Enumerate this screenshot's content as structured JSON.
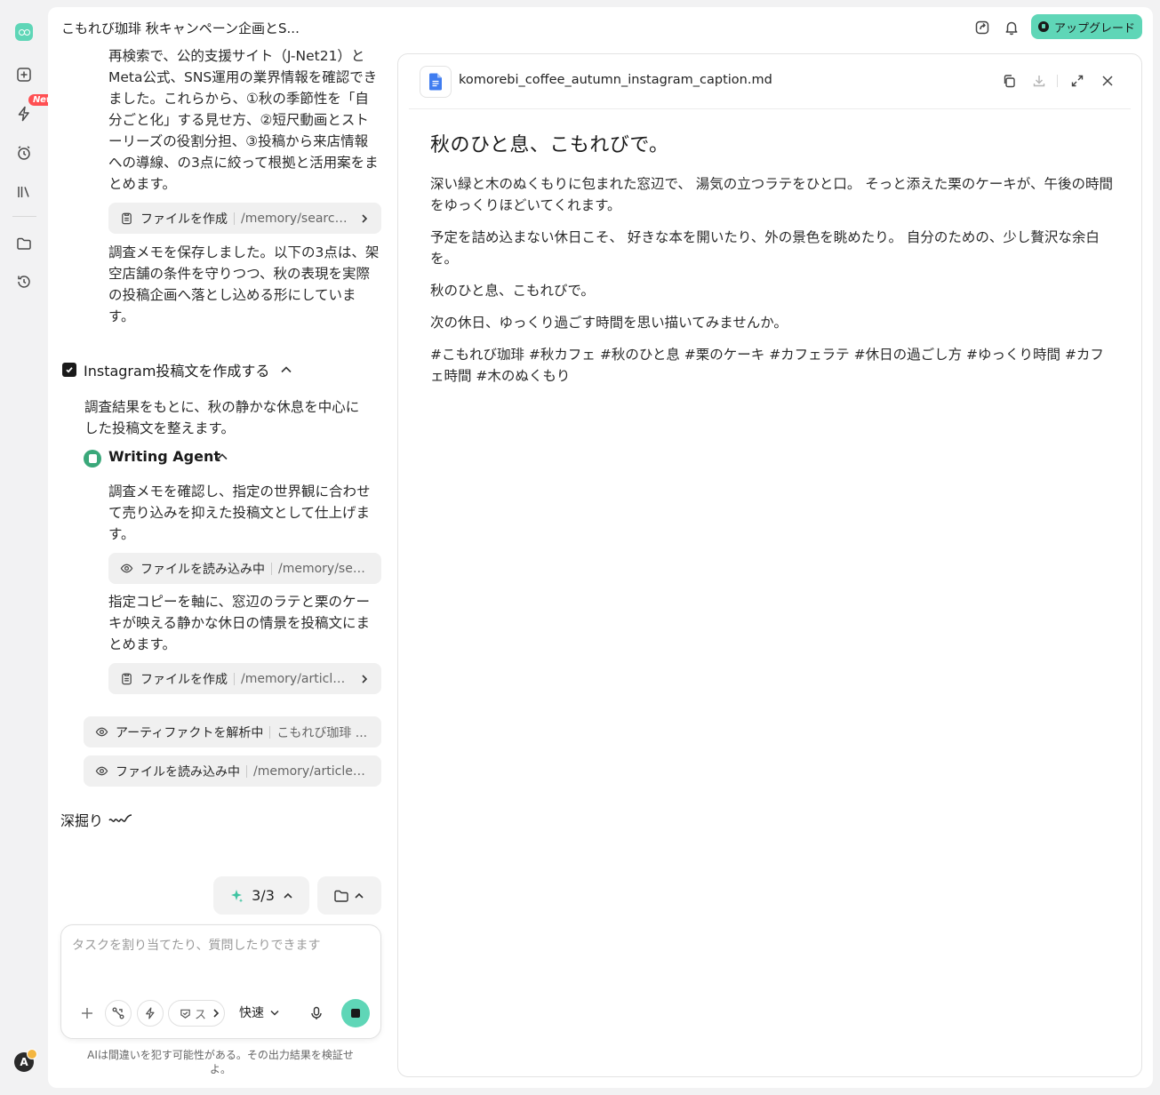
{
  "header": {
    "title": "こもれび珈琲 秋キャンペーン企画とS...",
    "upgrade_label": "アップグレード"
  },
  "sidebar": {
    "new_badge": "New",
    "avatar_initial": "A"
  },
  "chat": {
    "para1": "再検索で、公的支援サイト（J-Net21）とMeta公式、SNS運用の業界情報を確認できました。これらから、①秋の季節性を「自分ごと化」する見せ方、②短尺動画とストーリーズの役割分担、③投稿から来店情報への導線、の3点に絞って根拠と活用案をまとめます。",
    "chip1": {
      "action": "ファイルを作成",
      "path": "/memory/search/..."
    },
    "para2": "調査メモを保存しました。以下の3点は、架空店舗の条件を守りつつ、秋の表現を実際の投稿企画へ落とし込める形にしています。",
    "task_title": "Instagram投稿文を作成する",
    "task_desc": "調査結果をもとに、秋の静かな休息を中心にした投稿文を整えます。",
    "agent_name": "Writing Agent",
    "para3": "調査メモを確認し、指定の世界観に合わせて売り込みを抑えた投稿文として仕上げます。",
    "chip2": {
      "action": "ファイルを読み込み中",
      "path": "/memory/sear..."
    },
    "para4": "指定コピーを軸に、窓辺のラテと栗のケーキが映える静かな休日の情景を投稿文にまとめます。",
    "chip3": {
      "action": "ファイルを作成",
      "path": "/memory/articles/..."
    },
    "chip4": {
      "action": "アーティファクトを解析中",
      "path": "こもれび珈琲 ..."
    },
    "chip5": {
      "action": "ファイルを読み込み中",
      "path": "/memory/articles/k..."
    },
    "deep_label": "深掘り",
    "counter": "3/3"
  },
  "composer": {
    "placeholder": "タスクを割り当てたり、質問したりできます",
    "skill_label": "ス",
    "speed_label": "快速",
    "disclaimer": "AIは間違いを犯す可能性がある。その出力結果を検証せよ。"
  },
  "document": {
    "file_name": "komorebi_coffee_autumn_instagram_caption.md",
    "heading": "秋のひと息、こもれびで。",
    "paragraphs": [
      "深い緑と木のぬくもりに包まれた窓辺で、 湯気の立つラテをひと口。 そっと添えた栗のケーキが、午後の時間をゆっくりほどいてくれます。",
      "予定を詰め込まない休日こそ、 好きな本を開いたり、外の景色を眺めたり。 自分のための、少し贅沢な余白を。",
      "秋のひと息、こもれびで。",
      "次の休日、ゆっくり過ごす時間を思い描いてみませんか。",
      "#こもれび珈琲 #秋カフェ #秋のひと息 #栗のケーキ #カフェラテ #休日の過ごし方 #ゆっくり時間 #カフェ時間 #木のぬくもり"
    ]
  },
  "colors": {
    "accent": "#5fd6b7",
    "badge_red": "#ff4f52",
    "file_blue": "#3f7cf0"
  },
  "icons": [
    "logo-icon",
    "new-task-icon",
    "lightning-icon",
    "alarm-icon",
    "library-icon",
    "folder-icon",
    "history-icon",
    "share-icon",
    "bell-icon",
    "file-icon",
    "copy-icon",
    "download-icon",
    "expand-icon",
    "close-icon",
    "eye-icon",
    "clipboard-icon",
    "chevron-right-icon",
    "chevron-up-icon",
    "sparkle-icon",
    "plus-icon",
    "connector-icon",
    "mic-icon",
    "stop-icon"
  ]
}
